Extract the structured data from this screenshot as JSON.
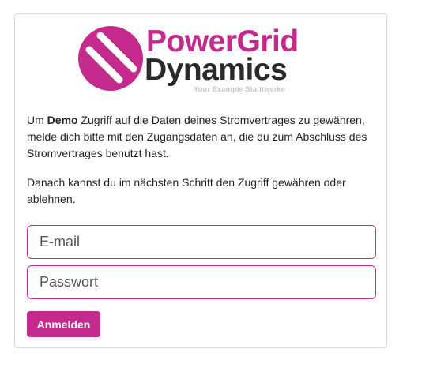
{
  "logo": {
    "line1": "PowerGrid",
    "line2": "Dynamics",
    "tagline": "Your Example Stadtwerke",
    "brand_color": "#c4298c",
    "dark_color": "#2a2a2a"
  },
  "intro": {
    "prefix": "Um ",
    "bold": "Demo",
    "suffix": " Zugriff auf die Daten deines Stromvertrages zu gewähren, melde dich bitte mit den Zugangsdaten an, die du zum Abschluss des Stromvertrages benutzt hast.",
    "second": "Danach kannst du im nächsten Schritt den Zugriff gewähren oder ablehnen."
  },
  "form": {
    "email_placeholder": "E-mail",
    "password_placeholder": "Passwort",
    "submit_label": "Anmelden"
  }
}
